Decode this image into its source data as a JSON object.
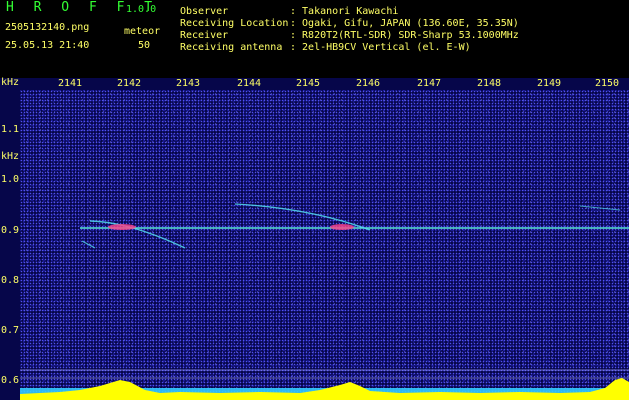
{
  "header": {
    "app_title": "H R O F F T",
    "version": "1.0.0",
    "filename": "2505132140.png",
    "datetime": "25.05.13 21:40",
    "mode_label": "meteor",
    "mode_value": "50",
    "info": [
      {
        "label": "Observer",
        "value": ": Takanori Kawachi"
      },
      {
        "label": "Receiving Location",
        "value": ": Ogaki, Gifu, JAPAN (136.60E, 35.35N)"
      },
      {
        "label": "Receiver",
        "value": ": R820T2(RTL-SDR) SDR-Sharp 53.1000MHz"
      },
      {
        "label": "Receiving antenna",
        "value": ": 2el-HB9CV Vertical (el. E-W)"
      }
    ]
  },
  "axes": {
    "y_unit": "kHz",
    "y_ticks": [
      "1.1",
      "kHz",
      "1.0",
      "0.9",
      "0.8",
      "0.7",
      "0.6"
    ],
    "x_ticks": [
      "2141",
      "2142",
      "2143",
      "2144",
      "2145",
      "2146",
      "2147",
      "2148",
      "2149",
      "2150"
    ]
  },
  "colors": {
    "background": "#06064a",
    "text": "#ffff66",
    "title": "#33ff33",
    "carrier": "#66ffee",
    "level": "#ffff00"
  }
}
